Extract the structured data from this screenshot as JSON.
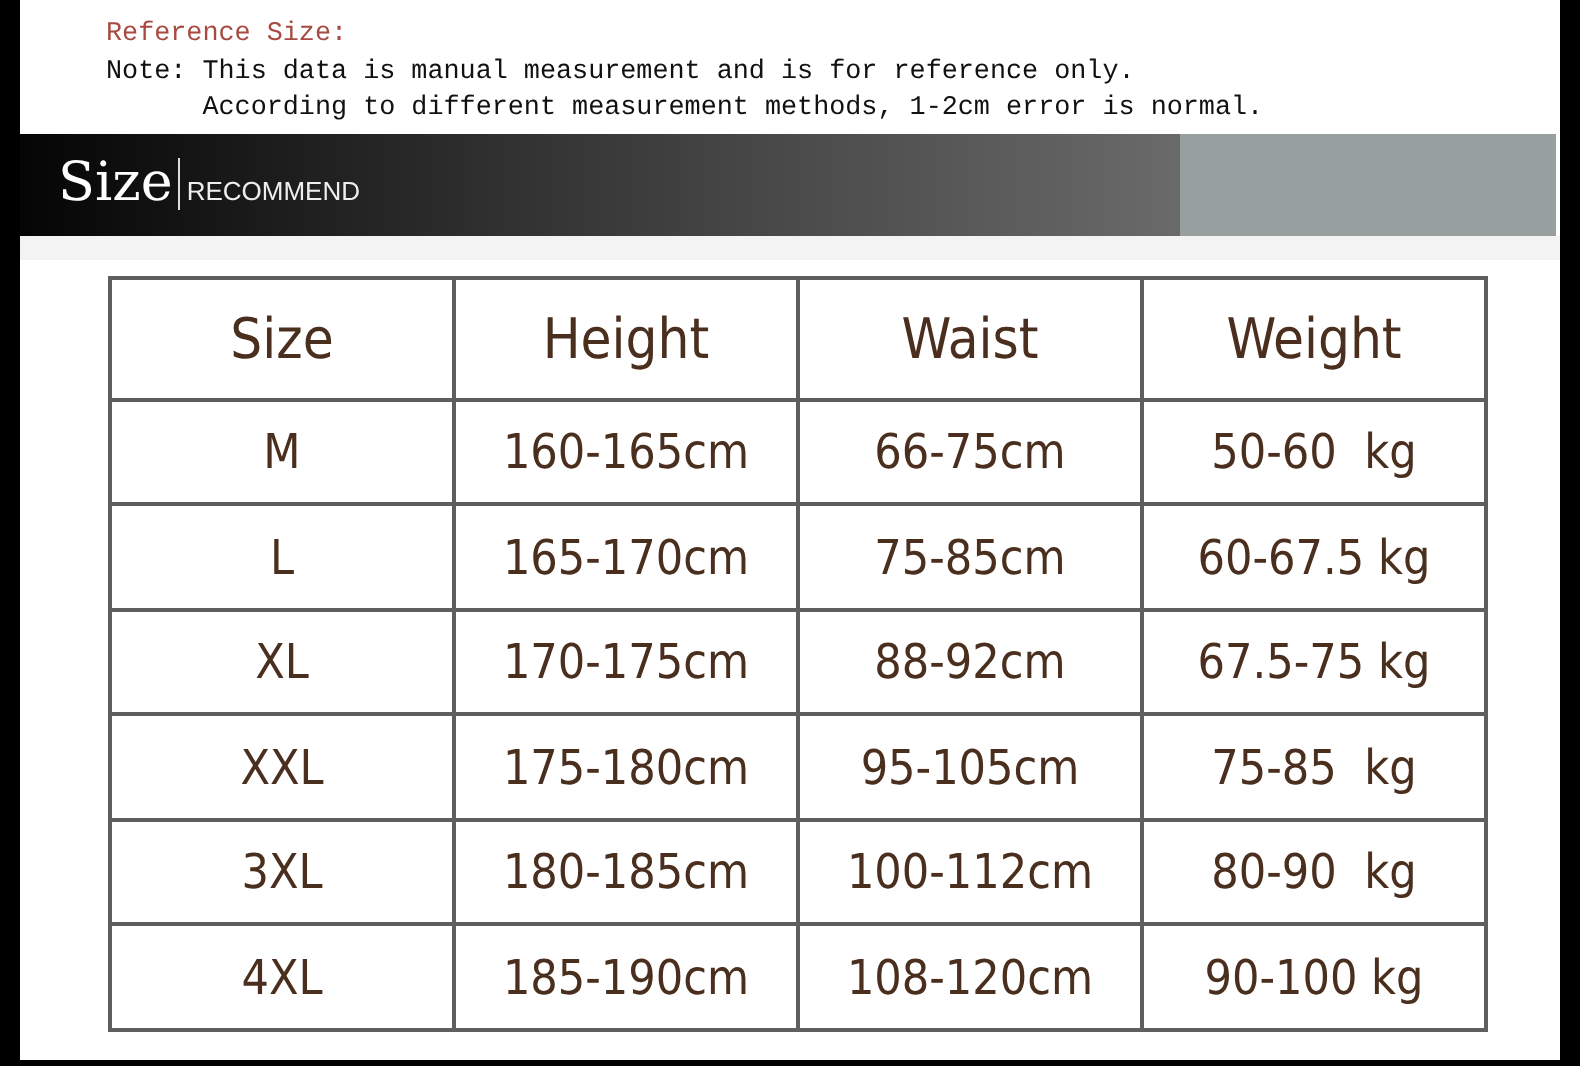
{
  "note": {
    "title": "Reference Size:",
    "lines": [
      "Note: This data is manual measurement and is for reference only.",
      "      According to different measurement methods, 1-2cm error is normal."
    ]
  },
  "banner": {
    "title": "Size",
    "subtitle": "RECOMMEND"
  },
  "table": {
    "columns": [
      "Size",
      "Height",
      "Waist",
      "Weight"
    ],
    "rows": [
      [
        "M",
        "160-165cm",
        "66-75cm",
        "50-60  kg"
      ],
      [
        "L",
        "165-170cm",
        "75-85cm",
        "60-67.5 kg"
      ],
      [
        "XL",
        "170-175cm",
        "88-92cm",
        "67.5-75 kg"
      ],
      [
        "XXL",
        "175-180cm",
        "95-105cm",
        "75-85  kg"
      ],
      [
        "3XL",
        "180-185cm",
        "100-112cm",
        "80-90  kg"
      ],
      [
        "4XL",
        "185-190cm",
        "108-120cm",
        "90-100 kg"
      ]
    ]
  }
}
